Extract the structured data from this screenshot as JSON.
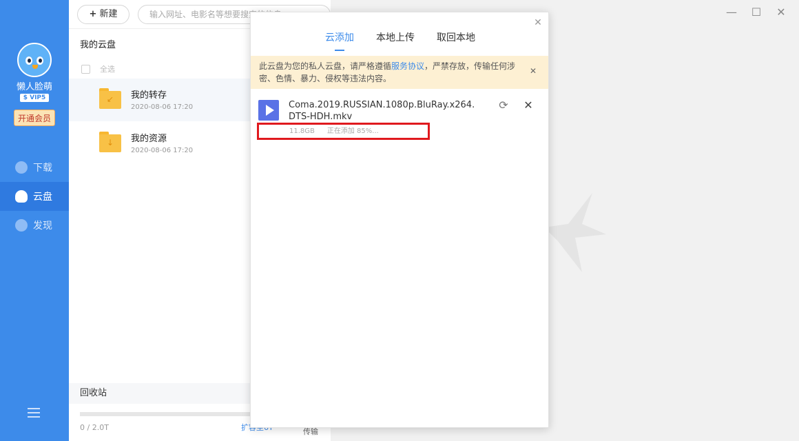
{
  "sidebar": {
    "username": "懒人脸萌",
    "vip_badge": "$ VIP5",
    "vip_button": "开通会员",
    "nav": [
      {
        "label": "下载",
        "icon": "download-icon"
      },
      {
        "label": "云盘",
        "icon": "cloud-icon"
      },
      {
        "label": "发现",
        "icon": "compass-icon"
      }
    ],
    "menu_icon": "hamburger-icon"
  },
  "toolbar": {
    "new_label": "新建",
    "search_placeholder": "输入网址、电影名等想要搜索的信息"
  },
  "filepanel": {
    "breadcrumb": "我的云盘",
    "select_all": "全选",
    "files": [
      {
        "name": "我的转存",
        "date": "2020-08-06 17:20"
      },
      {
        "name": "我的资源",
        "date": "2020-08-06 17:20"
      }
    ],
    "recycle": "回收站",
    "storage": "0 / 2.0T",
    "expand": "扩容至6T",
    "transfer": "传输"
  },
  "dialog": {
    "tabs": [
      "云添加",
      "本地上传",
      "取回本地"
    ],
    "active_tab": 0,
    "notice_pre": "此云盘为您的私人云盘，请严格遵循",
    "notice_link": "服务协议",
    "notice_post": "，严禁存放，传输任何涉密、色情、暴力、侵权等违法内容。",
    "task": {
      "name": "Coma.2019.RUSSIAN.1080p.BluRay.x264.DTS-HDH.mkv",
      "size": "11.8GB",
      "status": "正在添加 85%...",
      "progress": 0.85
    }
  },
  "colors": {
    "accent": "#3d8bea",
    "notice_bg": "#fdf0d3",
    "highlight": "#e0191e"
  }
}
